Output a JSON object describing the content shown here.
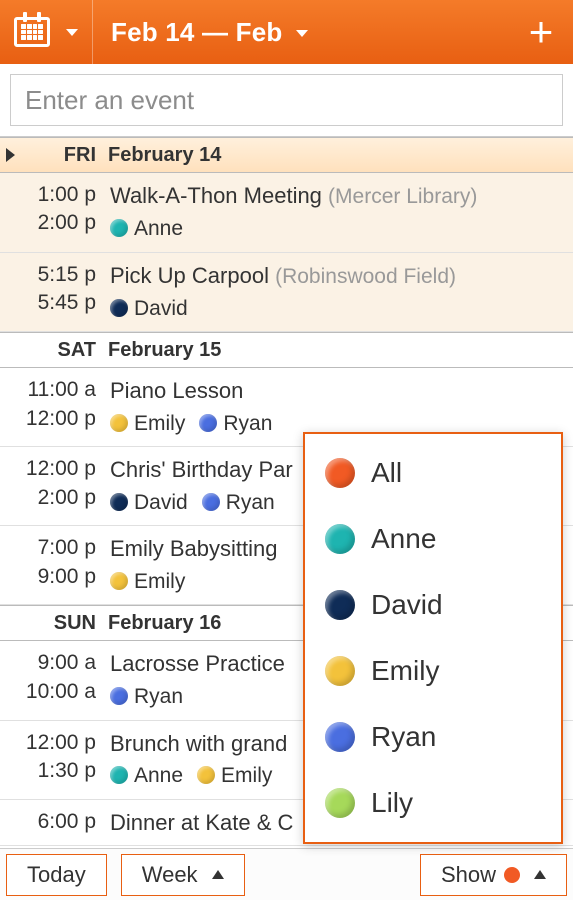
{
  "header": {
    "title": "Feb 14 — Feb"
  },
  "input": {
    "placeholder": "Enter an event",
    "value": ""
  },
  "colors": {
    "All": "#f15a24",
    "Anne": "#1eb4b0",
    "David": "#0f2c57",
    "Emily": "#f3c23b",
    "Ryan": "#4a6ee0",
    "Lily": "#a6d95a"
  },
  "days": [
    {
      "dow": "FRI",
      "date": "February 14",
      "today": true,
      "events": [
        {
          "start": "1:00 p",
          "end": "2:00 p",
          "title": "Walk-A-Thon Meeting",
          "location": "(Mercer Library)",
          "people": [
            "Anne"
          ],
          "tint": true
        },
        {
          "start": "5:15 p",
          "end": "5:45 p",
          "title": "Pick Up Carpool",
          "location": "(Robinswood Field)",
          "people": [
            "David"
          ],
          "tint": true
        }
      ]
    },
    {
      "dow": "SAT",
      "date": "February 15",
      "today": false,
      "events": [
        {
          "start": "11:00 a",
          "end": "12:00 p",
          "title": "Piano Lesson",
          "location": "",
          "people": [
            "Emily",
            "Ryan"
          ],
          "tint": false
        },
        {
          "start": "12:00 p",
          "end": "2:00 p",
          "title": "Chris' Birthday Par",
          "location": "",
          "people": [
            "David",
            "Ryan"
          ],
          "tint": false
        },
        {
          "start": "7:00 p",
          "end": "9:00 p",
          "title": "Emily Babysitting",
          "location": "",
          "people": [
            "Emily"
          ],
          "tint": false
        }
      ]
    },
    {
      "dow": "SUN",
      "date": "February 16",
      "today": false,
      "events": [
        {
          "start": "9:00 a",
          "end": "10:00 a",
          "title": "Lacrosse Practice",
          "location": "",
          "people": [
            "Ryan"
          ],
          "tint": false
        },
        {
          "start": "12:00 p",
          "end": "1:30 p",
          "title": "Brunch with grand",
          "location": "",
          "people": [
            "Anne",
            "Emily"
          ],
          "tint": false
        },
        {
          "start": "6:00 p",
          "end": "",
          "title": "Dinner at Kate & C",
          "location": "",
          "people": [],
          "tint": false
        }
      ]
    }
  ],
  "bottom": {
    "today": "Today",
    "week": "Week",
    "show": "Show",
    "show_color": "#f15a24"
  },
  "popup": {
    "items": [
      "All",
      "Anne",
      "David",
      "Emily",
      "Ryan",
      "Lily"
    ]
  }
}
